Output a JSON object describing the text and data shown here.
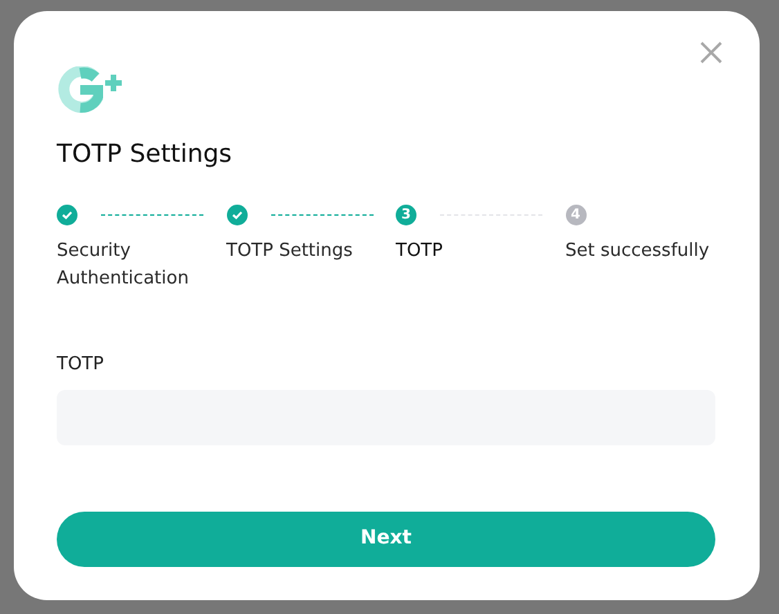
{
  "dialog": {
    "title": "TOTP Settings",
    "steps": [
      {
        "label": "Security Authentication",
        "done": true,
        "selected": false
      },
      {
        "label": "TOTP Settings",
        "done": true,
        "selected": false
      },
      {
        "label": "TOTP",
        "done": false,
        "selected": true,
        "number": "3"
      },
      {
        "label": "Set successfully",
        "done": false,
        "selected": false,
        "number": "4"
      }
    ],
    "field": {
      "label": "TOTP"
    },
    "button": "Next"
  }
}
